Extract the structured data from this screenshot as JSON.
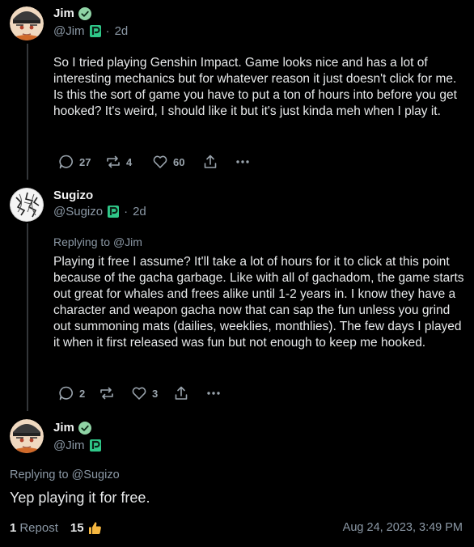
{
  "posts": [
    {
      "name": "Jim",
      "handle": "@Jim",
      "time": "2d",
      "verified": true,
      "text": "So I tried playing Genshin Impact.  Game looks nice and has a lot of interesting mechanics but for whatever reason it just doesn't click for me.  Is this the sort of game you have to put a ton of hours into before you get hooked?  It's weird, I should like it but it's just kinda meh when I play it.",
      "stats": {
        "replies": "27",
        "reposts": "4",
        "likes": "60"
      }
    },
    {
      "name": "Sugizo",
      "handle": "@Sugizo",
      "time": "2d",
      "reply_label": "Replying to",
      "reply_to": "@Jim",
      "text": "Playing it free I assume? It'll take a lot of hours for it to click at this point because of the gacha garbage. Like with all of gachadom, the game starts out great for whales and frees alike until 1-2 years in. I know they have a character and weapon gacha now that can sap the fun unless you grind out summoning mats (dailies, weeklies, monthlies). The few days I played it when it first released was fun but not enough to keep me hooked.",
      "stats": {
        "replies": "2",
        "reposts": "",
        "likes": "3"
      }
    },
    {
      "name": "Jim",
      "handle": "@Jim",
      "verified": true,
      "reply_label": "Replying to",
      "reply_to": "@Sugizo",
      "text": "Yep playing it for free.",
      "footer": {
        "reposts_count": "1",
        "reposts_label": "Repost",
        "likes_count": "15",
        "timestamp": "Aug 24, 2023, 3:49 PM"
      }
    }
  ],
  "colors": {
    "background": "#000000",
    "text": "#e7e9ea",
    "muted": "#8b98a5",
    "verified": "#8fd3a5",
    "badge": "#2fc889",
    "thumb": "#f5b740"
  }
}
